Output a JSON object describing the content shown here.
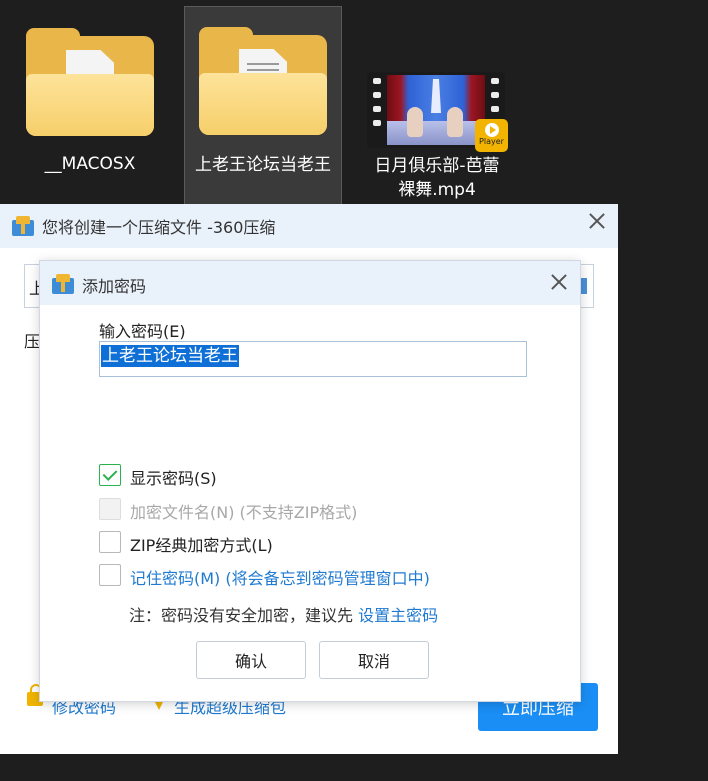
{
  "desktop": {
    "items": [
      {
        "label": "__MACOSX",
        "type": "folder",
        "selected": false
      },
      {
        "label": "上老王论坛当老王",
        "type": "folder",
        "selected": true
      },
      {
        "label": "日月俱乐部-芭蕾裸舞.mp4",
        "type": "video",
        "selected": false,
        "badge": "Player"
      }
    ]
  },
  "main_window": {
    "title": "您将创建一个压缩文件 -360压缩",
    "path_fragment": "上",
    "label_fragment": "压",
    "modify_password_link": "修改密码",
    "generate_sfx_link": "生成超级压缩包",
    "compress_now_button": "立即压缩"
  },
  "password_dialog": {
    "title": "添加密码",
    "input_label": "输入密码(E)",
    "password_value": "上老王论坛当老王",
    "options": [
      {
        "label": "显示密码(S)",
        "checked": true,
        "disabled": false,
        "link": false
      },
      {
        "label": "加密文件名(N) (不支持ZIP格式)",
        "checked": false,
        "disabled": true,
        "link": false
      },
      {
        "label": "ZIP经典加密方式(L)",
        "checked": false,
        "disabled": false,
        "link": false
      },
      {
        "label": "记住密码(M) (将会备忘到密码管理窗口中)",
        "checked": false,
        "disabled": false,
        "link": true
      }
    ],
    "note_text": "注：密码没有安全加密，建议先",
    "note_link": "设置主密码",
    "ok_button": "确认",
    "cancel_button": "取消"
  },
  "colors": {
    "title_bar_bg": "#e9f1fb",
    "link_blue": "#1f7ad0",
    "primary_button": "#1a8ef5",
    "check_green": "#2bb14d",
    "folder_yellow": "#f6cf6a"
  }
}
